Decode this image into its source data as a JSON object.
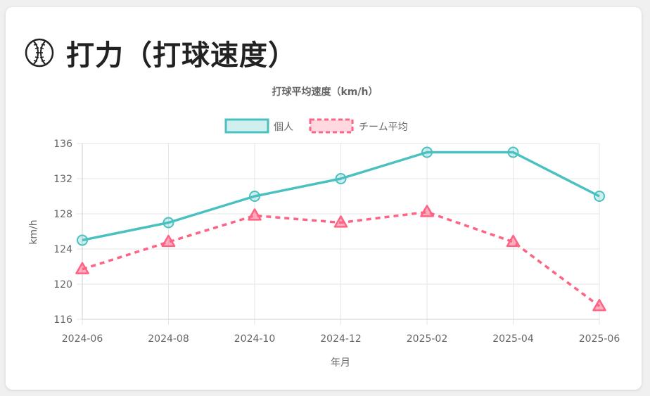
{
  "header": {
    "icon": "baseball-icon",
    "title": "打力（打球速度）"
  },
  "colors": {
    "individual": "#4bc0c0",
    "team": "#ff6384",
    "grid": "#e6e6e6"
  },
  "chart_data": {
    "type": "line",
    "title": "打球平均速度（km/h）",
    "xlabel": "年月",
    "ylabel": "km/h",
    "ylim": [
      116,
      136
    ],
    "yticks": [
      "136",
      "132",
      "128",
      "124",
      "120",
      "116"
    ],
    "categories": [
      "2024-06",
      "2024-08",
      "2024-10",
      "2024-12",
      "2025-02",
      "2025-04",
      "2025-06"
    ],
    "legend_position": "top",
    "grid": true,
    "series": [
      {
        "name": "個人",
        "values": [
          125,
          127,
          130,
          132,
          135,
          135,
          130
        ],
        "marker": "circle",
        "line": "solid"
      },
      {
        "name": "チーム平均",
        "values": [
          121.7,
          124.8,
          127.8,
          127.0,
          128.2,
          124.8,
          117.5
        ],
        "marker": "triangle",
        "line": "dashed"
      }
    ]
  }
}
